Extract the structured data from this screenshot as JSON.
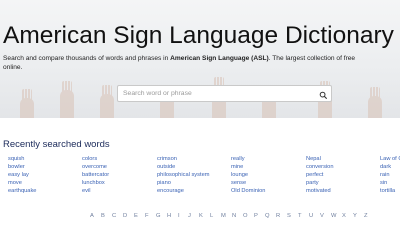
{
  "header": {
    "title": "American Sign Language Dictionary",
    "subtitle_part1": "Search and compare thousands of words and phrases in ",
    "subtitle_bold": "American Sign Language (ASL)",
    "subtitle_part2": ". The largest collection of free",
    "subtitle_line2": "online."
  },
  "search": {
    "placeholder": "Search word or phrase",
    "icon": "search-icon"
  },
  "recent": {
    "title": "Recently searched words",
    "columns": [
      [
        "squish",
        "bowler",
        "easy lay",
        "move",
        "earthquake"
      ],
      [
        "colors",
        "overcome",
        "battercator",
        "lunchbox",
        "evil"
      ],
      [
        "crimson",
        "outside",
        "philosophical system",
        "piano",
        "encourage"
      ],
      [
        "really",
        "mine",
        "lounge",
        "sense",
        "Old Dominion"
      ],
      [
        "Nepal",
        "conversion",
        "perfect",
        "party",
        "motivated"
      ],
      [
        "Law of G",
        "dark",
        "rain",
        "sin",
        "tortilla"
      ]
    ]
  },
  "alphabet": [
    "A",
    "B",
    "C",
    "D",
    "E",
    "F",
    "G",
    "H",
    "I",
    "J",
    "K",
    "L",
    "M",
    "N",
    "O",
    "P",
    "Q",
    "R",
    "S",
    "T",
    "U",
    "V",
    "W",
    "X",
    "Y",
    "Z"
  ]
}
